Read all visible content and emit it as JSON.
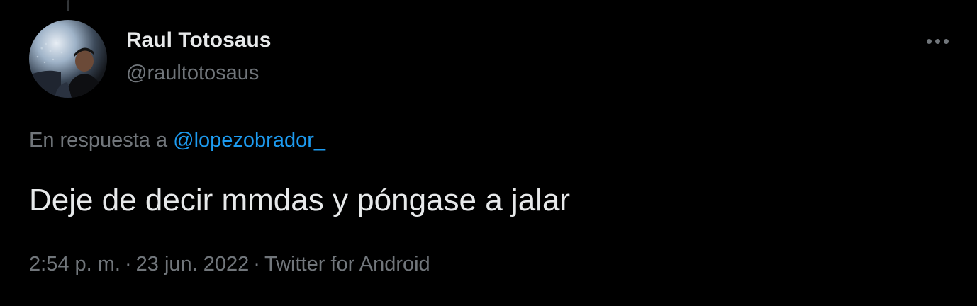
{
  "tweet": {
    "author": {
      "display_name": "Raul Totosaus",
      "handle": "@raultotosaus"
    },
    "reply_prefix": "En respuesta a",
    "reply_to": "@lopezobrador_",
    "text": "Deje de decir mmdas y póngase a jalar",
    "time": "2:54 p. m.",
    "date": "23 jun. 2022",
    "source": "Twitter for Android",
    "separator": "·",
    "more_icon": "more-horizontal-icon"
  },
  "colors": {
    "background": "#000000",
    "primary_text": "#e7e9ea",
    "secondary_text": "#71767b",
    "link": "#1d9bf0"
  }
}
